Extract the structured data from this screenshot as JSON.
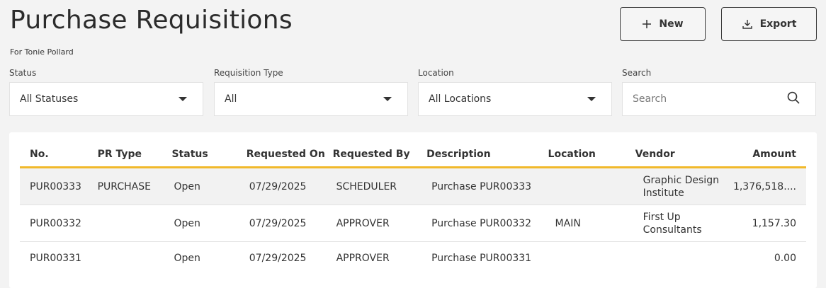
{
  "header": {
    "title": "Purchase Requisitions",
    "subtitle": "For Tonie Pollard",
    "new_label": "New",
    "export_label": "Export"
  },
  "filters": {
    "status": {
      "label": "Status",
      "value": "All Statuses"
    },
    "type": {
      "label": "Requisition Type",
      "value": "All"
    },
    "location": {
      "label": "Location",
      "value": "All Locations"
    },
    "search": {
      "label": "Search",
      "placeholder": "Search"
    }
  },
  "table": {
    "columns": [
      "No.",
      "PR Type",
      "Status",
      "Requested On",
      "Requested By",
      "Description",
      "Location",
      "Vendor",
      "Amount"
    ],
    "rows": [
      {
        "no": "PUR00333",
        "type": "PURCHASE",
        "status": "Open",
        "date": "07/29/2025",
        "by": "SCHEDULER",
        "desc": "Purchase PUR00333",
        "location": "",
        "vendor": "Graphic Design Institute",
        "amount": "1,376,518...."
      },
      {
        "no": "PUR00332",
        "type": "",
        "status": "Open",
        "date": "07/29/2025",
        "by": "APPROVER",
        "desc": "Purchase PUR00332",
        "location": "MAIN",
        "vendor": "First Up Consultants",
        "amount": "1,157.30"
      },
      {
        "no": "PUR00331",
        "type": "",
        "status": "Open",
        "date": "07/29/2025",
        "by": "APPROVER",
        "desc": "Purchase PUR00331",
        "location": "",
        "vendor": "",
        "amount": "0.00"
      }
    ]
  },
  "colors": {
    "accent": "#f1b92b",
    "background": "#f3f3f3"
  }
}
